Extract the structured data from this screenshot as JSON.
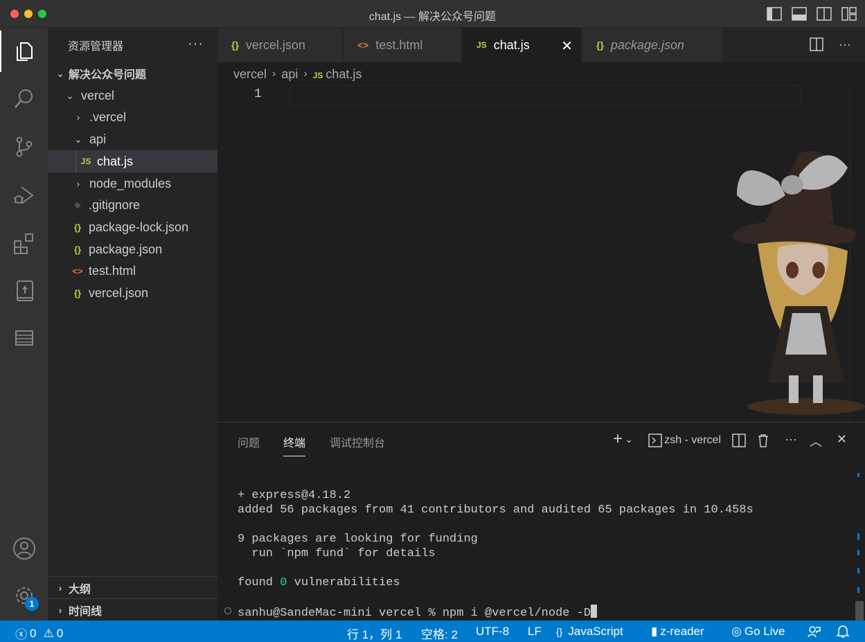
{
  "window": {
    "title": "chat.js — 解决公众号问题"
  },
  "activity_bar": {
    "items": [
      "explorer-icon",
      "search-icon",
      "source-control-icon",
      "run-debug-icon",
      "extensions-icon",
      "book-icon",
      "database-icon"
    ],
    "accounts": "account-icon",
    "settings": "settings-gear-icon",
    "settings_badge": "1"
  },
  "sidebar": {
    "title": "资源管理器",
    "more": "···",
    "tree": [
      {
        "label": "解决公众号问题",
        "type": "folder-root",
        "expanded": true
      },
      {
        "label": "vercel",
        "type": "folder",
        "expanded": true
      },
      {
        "label": ".vercel",
        "type": "folder",
        "expanded": false
      },
      {
        "label": "api",
        "type": "folder",
        "expanded": true
      },
      {
        "label": "chat.js",
        "type": "js",
        "icon_text": "JS",
        "selected": true
      },
      {
        "label": "node_modules",
        "type": "folder",
        "expanded": false
      },
      {
        "label": ".gitignore",
        "type": "git",
        "icon_text": "◆"
      },
      {
        "label": "package-lock.json",
        "type": "json",
        "icon_text": "{}"
      },
      {
        "label": "package.json",
        "type": "json",
        "icon_text": "{}"
      },
      {
        "label": "test.html",
        "type": "html",
        "icon_text": "<>"
      },
      {
        "label": "vercel.json",
        "type": "json",
        "icon_text": "{}"
      }
    ],
    "outline_label": "大纲",
    "timeline_label": "时间线"
  },
  "tabs": [
    {
      "label": "vercel.json",
      "icon_text": "{}",
      "active": false
    },
    {
      "label": "test.html",
      "icon_text": "<>",
      "active": false
    },
    {
      "label": "chat.js",
      "icon_text": "JS",
      "active": true
    },
    {
      "label": "package.json",
      "icon_text": "{}",
      "active": false,
      "italic": true
    }
  ],
  "tab_close": "✕",
  "breadcrumb": {
    "parts": [
      "vercel",
      "api",
      "chat.js"
    ],
    "file_icon_text": "JS"
  },
  "editor": {
    "line_numbers": [
      "1"
    ]
  },
  "panel": {
    "tabs": [
      "问题",
      "终端",
      "调试控制台"
    ],
    "active_tab": "终端",
    "terminal_name": "zsh - vercel",
    "terminal_lines": [
      "+ express@4.18.2",
      "added 56 packages from 41 contributors and audited 65 packages in 10.458s",
      "",
      "9 packages are looking for funding",
      "  run `npm fund` for details",
      "",
      "found ",
      "0",
      " vulnerabilities",
      "",
      "sanhu@SandeMac-mini vercel % npm i @vercel/node -D"
    ]
  },
  "statusbar": {
    "errors": "0",
    "warnings": "0",
    "position": "行 1，列 1",
    "indent": "空格: 2",
    "encoding": "UTF-8",
    "eol": "LF",
    "language": "JavaScript",
    "language_icon_text": "{}",
    "reader": "z-reader",
    "golive": "Go Live",
    "colors": {
      "background": "#007acc",
      "text": "#ffffff"
    }
  }
}
